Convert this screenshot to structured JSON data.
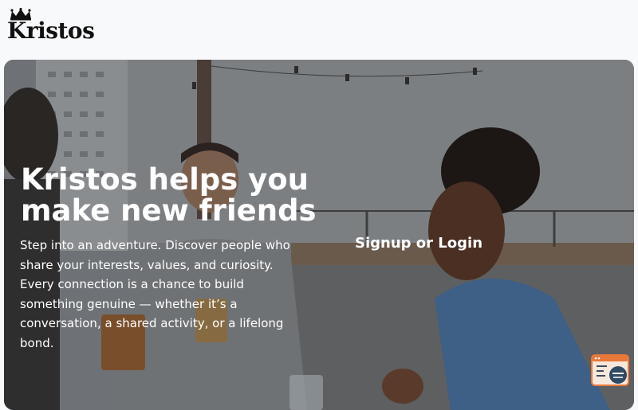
{
  "brand": {
    "name": "Kristos",
    "logo_icon": "crown-icon"
  },
  "hero": {
    "title": "Kristos helps you make new friends",
    "description": "Step into an adventure. Discover people who share your interests, values, and curiosity. Every connection is a chance to build something genuine — whether it’s a conversation, a shared activity, or a lifelong bond.",
    "cta_label": "Signup or Login",
    "background_image": "rooftop-friends-photo"
  },
  "widget": {
    "icon": "chat-support-icon",
    "accent_color": "#e8773a"
  },
  "colors": {
    "page_background": "#f8f9fb",
    "hero_text": "#ffffff",
    "logo_text": "#111111"
  }
}
